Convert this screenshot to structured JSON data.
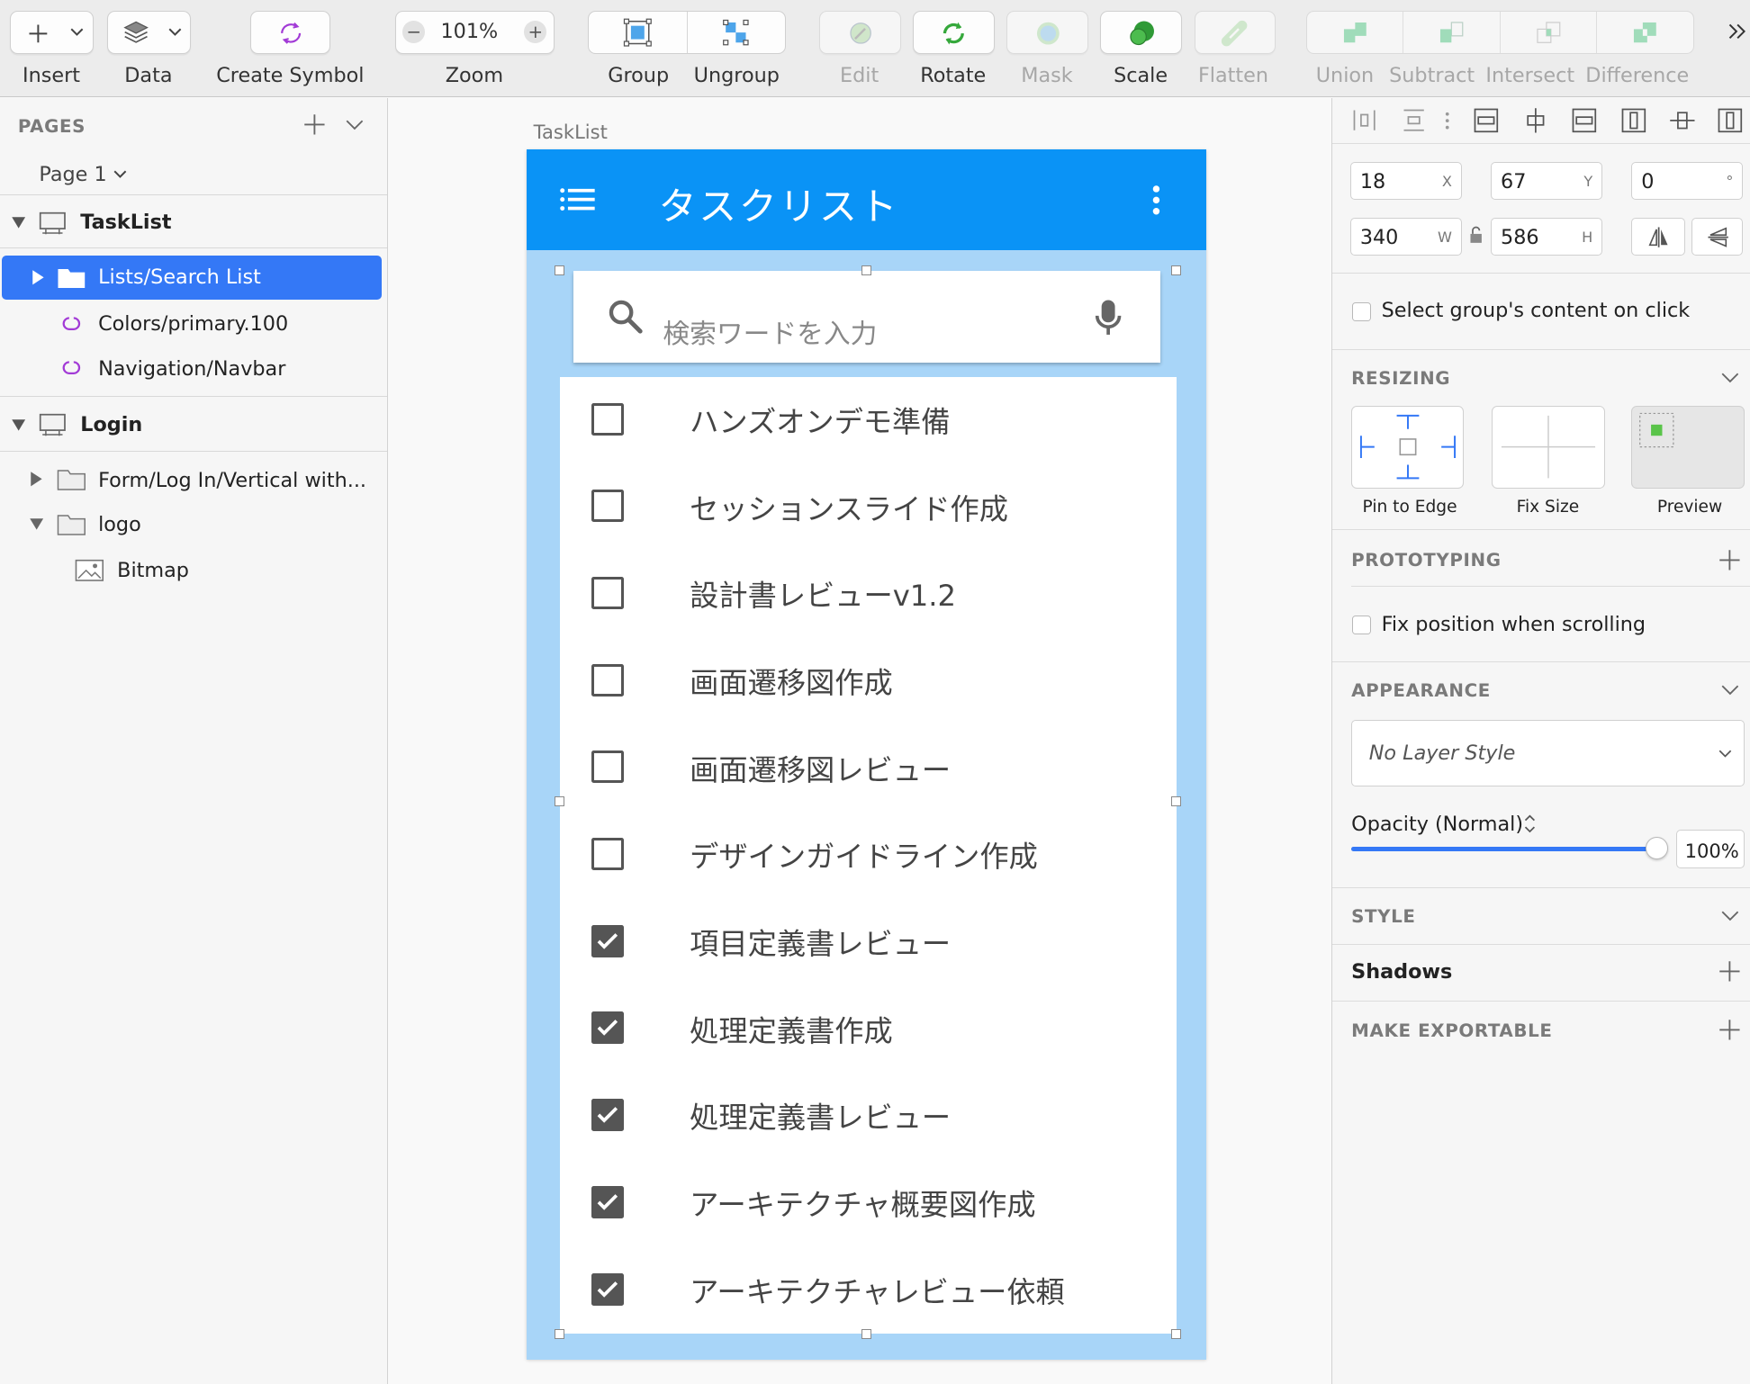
{
  "toolbar": {
    "insert": "Insert",
    "data": "Data",
    "create_symbol": "Create Symbol",
    "zoom_label": "Zoom",
    "zoom_value": "101%",
    "group": "Group",
    "ungroup": "Ungroup",
    "edit": "Edit",
    "rotate": "Rotate",
    "mask": "Mask",
    "scale": "Scale",
    "flatten": "Flatten",
    "union": "Union",
    "subtract": "Subtract",
    "intersect": "Intersect",
    "difference": "Difference"
  },
  "layers": {
    "pages_header": "PAGES",
    "page_name": "Page 1",
    "items": [
      {
        "label": "TaskList"
      },
      {
        "label": "Lists/Search List"
      },
      {
        "label": "Colors/primary.100"
      },
      {
        "label": "Navigation/Navbar"
      },
      {
        "label": "Login"
      },
      {
        "label": "Form/Log In/Vertical with..."
      },
      {
        "label": "logo"
      },
      {
        "label": "Bitmap"
      }
    ]
  },
  "canvas": {
    "artboard_label": "TaskList",
    "nav_title": "タスクリスト",
    "search_placeholder": "検索ワードを入力",
    "tasks": [
      {
        "label": "ハンズオンデモ準備",
        "checked": false
      },
      {
        "label": "セッションスライド作成",
        "checked": false
      },
      {
        "label": "設計書レビューv1.2",
        "checked": false
      },
      {
        "label": "画面遷移図作成",
        "checked": false
      },
      {
        "label": "画面遷移図レビュー",
        "checked": false
      },
      {
        "label": "デザインガイドライン作成",
        "checked": false
      },
      {
        "label": "項目定義書レビュー",
        "checked": true
      },
      {
        "label": "処理定義書作成",
        "checked": true
      },
      {
        "label": "処理定義書レビュー",
        "checked": true
      },
      {
        "label": "アーキテクチャ概要図作成",
        "checked": true
      },
      {
        "label": "アーキテクチャレビュー依頼",
        "checked": true
      }
    ]
  },
  "inspector": {
    "x": "18",
    "x_label": "X",
    "y": "67",
    "y_label": "Y",
    "rotation": "0",
    "rotation_unit": "°",
    "w": "340",
    "w_label": "W",
    "h": "586",
    "h_label": "H",
    "select_group_content": "Select group's content on click",
    "resizing_header": "RESIZING",
    "pin_to_edge": "Pin to Edge",
    "fix_size": "Fix Size",
    "preview": "Preview",
    "prototyping_header": "PROTOTYPING",
    "fix_position": "Fix position when scrolling",
    "appearance_header": "APPEARANCE",
    "layer_style": "No Layer Style",
    "opacity_label": "Opacity (Normal)",
    "opacity_value": "100%",
    "opacity_level": 1.0,
    "style_header": "STYLE",
    "shadows": "Shadows",
    "make_exportable": "MAKE EXPORTABLE"
  },
  "colors": {
    "accent": "#3478f6",
    "navbar": "#0a93f6",
    "selection": "#a8d5f8",
    "symbol": "#a23ad6"
  }
}
